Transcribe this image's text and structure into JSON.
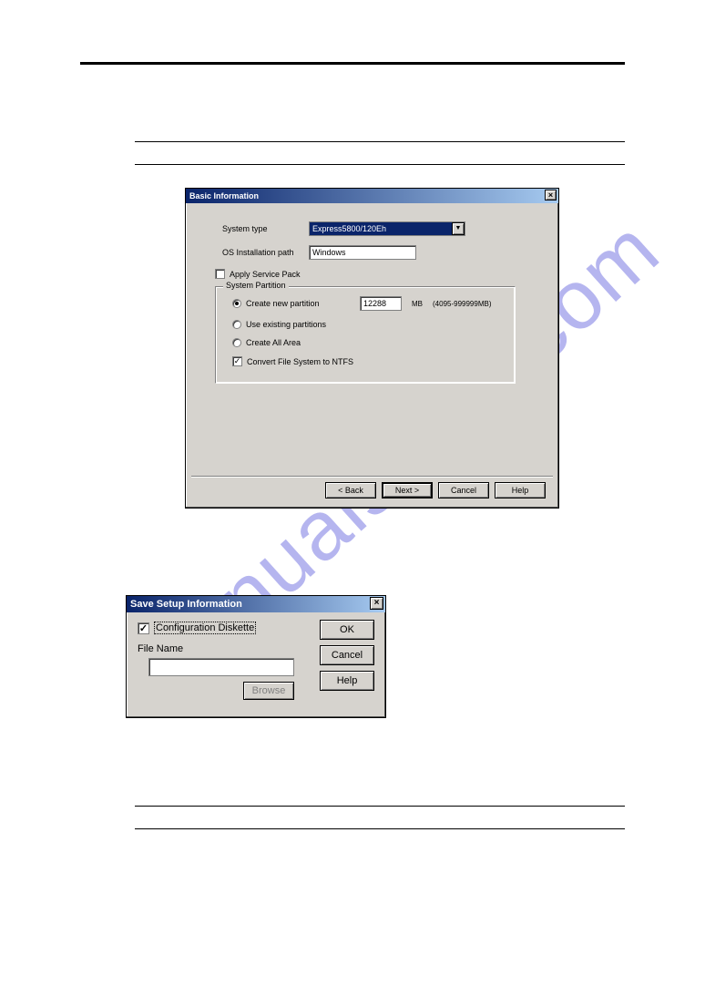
{
  "watermark": "manualshive.com",
  "dlg1": {
    "title": "Basic Information",
    "close_x": "×",
    "system_type_label": "System type",
    "system_type_value": "Express5800/120Eh",
    "combo_arrow": "▼",
    "os_path_label": "OS Installation path",
    "os_path_value": "Windows",
    "apply_sp_label": "Apply Service Pack",
    "group_legend": "System Partition",
    "radio_new": "Create new partition",
    "partition_size": "12288",
    "mb_unit": "MB",
    "mb_range": "(4095-999999MB)",
    "radio_existing": "Use existing partitions",
    "radio_all": "Create All Area",
    "ntfs_label": "Convert File System to NTFS",
    "btn_back": "< Back",
    "btn_next": "Next >",
    "btn_cancel": "Cancel",
    "btn_help": "Help"
  },
  "dlg2": {
    "title": "Save Setup Information",
    "close_x": "×",
    "diskette_label": "Configuration Diskette",
    "filename_label": "File Name",
    "browse_label": "Browse",
    "btn_ok": "OK",
    "btn_cancel": "Cancel",
    "btn_help": "Help",
    "checkmark": "✓"
  }
}
